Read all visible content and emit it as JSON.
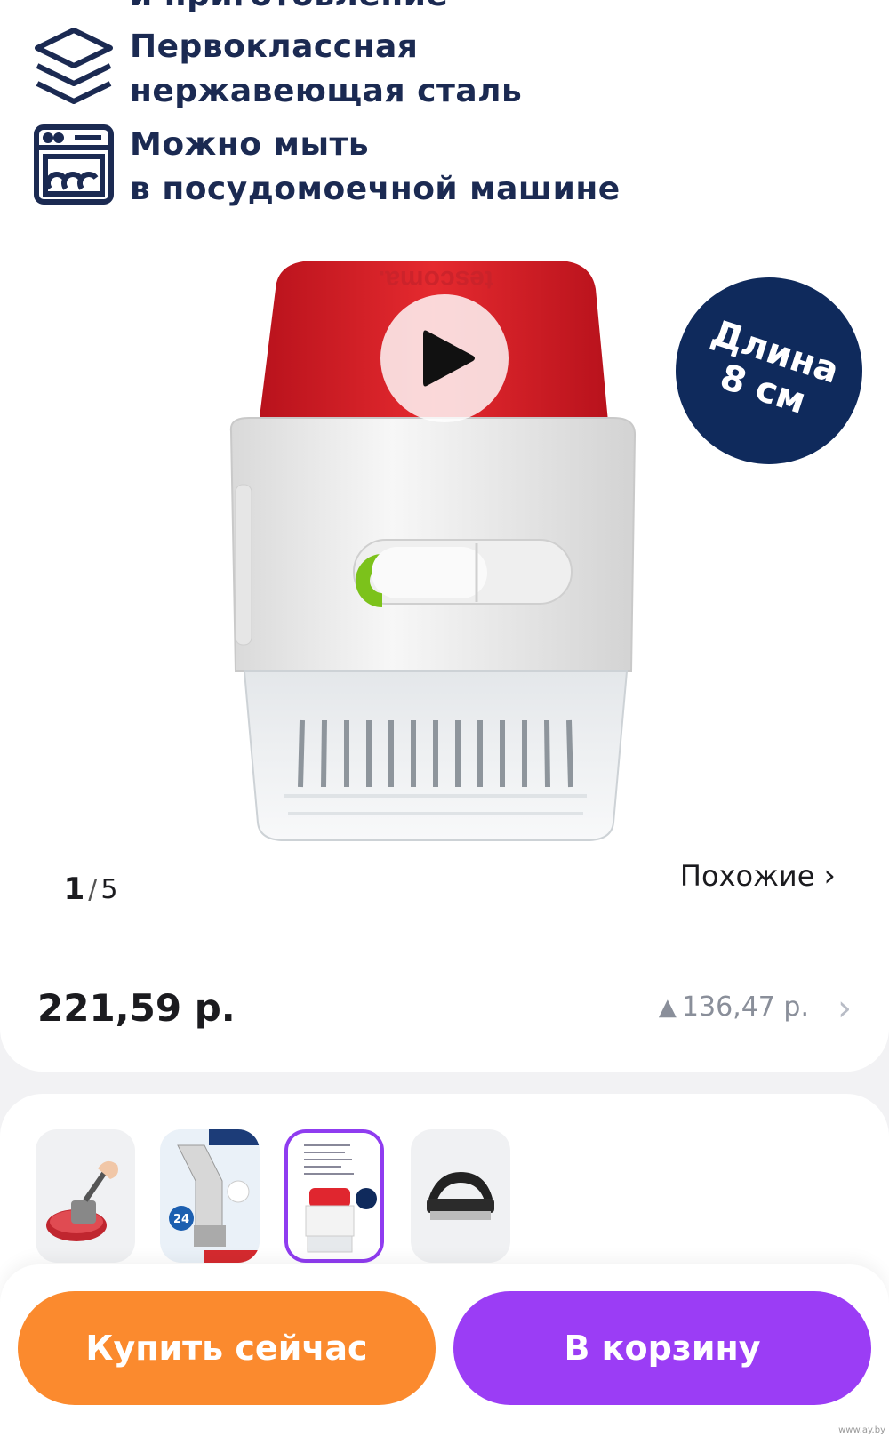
{
  "features": {
    "partial_top_text": "и приготовление",
    "items": [
      {
        "icon": "layers-icon",
        "lines": [
          "Первокласcная",
          "нержавеющая сталь"
        ]
      },
      {
        "icon": "dishwasher-icon",
        "lines": [
          "Можно мыть",
          "в посудомоечной машине"
        ]
      }
    ]
  },
  "gallery": {
    "brand_on_product": "tescoma.",
    "badge_lines": [
      "Длина",
      "8 см"
    ],
    "counter_current": "1",
    "counter_separator": "/",
    "counter_total": "5",
    "similar_label": "Похожие",
    "similar_chevron": "›"
  },
  "price": {
    "main": "221,59 р.",
    "alt_arrow": "▲",
    "alt_value": "136,47 р.",
    "chevron": "›"
  },
  "thumbnails": [
    {
      "name": "thumb-meat-tenderizer-hand",
      "selected": false
    },
    {
      "name": "thumb-tenderizer-package",
      "selected": false,
      "label": "24"
    },
    {
      "name": "thumb-current-product",
      "selected": true
    },
    {
      "name": "thumb-black-tenderizer",
      "selected": false
    }
  ],
  "actions": {
    "buy_now": "Купить сейчас",
    "add_to_cart": "В корзину"
  },
  "colors": {
    "buy_button": "#fb8a2e",
    "cart_button": "#9b3df5",
    "badge": "#0f2a5c",
    "feature_text": "#1b2a52"
  },
  "watermark": "www.ay.by"
}
